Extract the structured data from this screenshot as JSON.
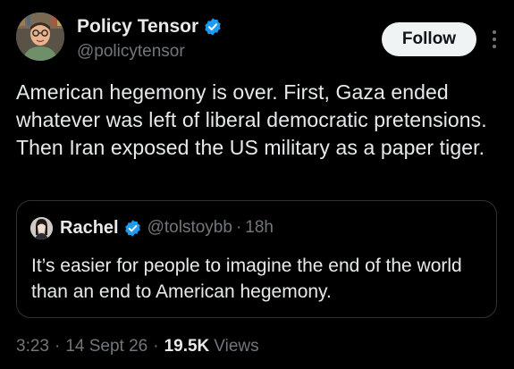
{
  "author": {
    "display_name": "Policy Tensor",
    "handle": "@policytensor",
    "verified": true
  },
  "follow_label": "Follow",
  "tweet_text": "American hegemony is over. First, Gaza ended whatever was left of liberal democratic pretensions. Then Iran exposed the US military as a paper tiger.",
  "quote": {
    "display_name": "Rachel",
    "handle": "@tolstoybb",
    "separator": "·",
    "time": "18h",
    "verified": true,
    "text": "It’s easier for people to imagine the end of the world than an end to American hegemony."
  },
  "meta": {
    "time": "3:23",
    "date": "14 Sept 26",
    "views_count": "19.5K",
    "views_label": "Views",
    "separator": "·"
  },
  "icons": {
    "verified": "verified-badge-icon",
    "more": "more-options-icon"
  },
  "colors": {
    "background": "#000000",
    "text_primary": "#e7e9ea",
    "text_secondary": "#71767b",
    "verified_blue": "#1d9bf0",
    "follow_bg": "#eff3f4",
    "border": "#2f3336"
  }
}
